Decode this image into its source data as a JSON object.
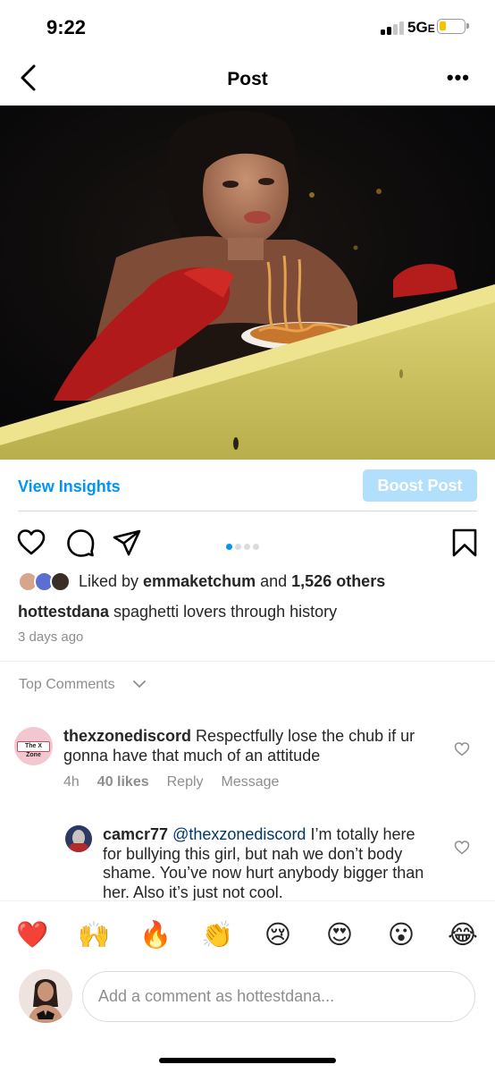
{
  "status_bar": {
    "time": "9:22",
    "network": "5G",
    "network_suffix": "E"
  },
  "nav": {
    "title": "Post",
    "more": "•••"
  },
  "insights": {
    "view_insights": "View Insights",
    "boost_post": "Boost Post"
  },
  "carousel": {
    "count": 4,
    "active_index": 0
  },
  "likes": {
    "prefix": "Liked by ",
    "user": "emmaketchum",
    "middle": " and ",
    "others": "1,526 others"
  },
  "caption": {
    "username": "hottestdana",
    "text": " spaghetti lovers through history"
  },
  "posted": "3 days ago",
  "top_comments_label": "Top Comments",
  "comments": [
    {
      "username": "thexzonediscord",
      "text": " Respectfully lose the chub if ur gonna have that much of an attitude",
      "time": "4h",
      "likes": "40 likes",
      "reply": "Reply",
      "message": "Message",
      "avatar_text": "The X Zone"
    },
    {
      "username": "camcr77",
      "mention": "@thexzonediscord",
      "text": " I’m totally here for bullying this girl, but nah we don’t body shame. You’ve now hurt anybody bigger than her. Also it’s just not cool."
    }
  ],
  "emoji_reactions": [
    "❤️",
    "🙌",
    "🔥",
    "👏",
    "😢",
    "😍",
    "😮",
    "😂"
  ],
  "composer": {
    "placeholder": "Add a comment as hottestdana..."
  },
  "colors": {
    "accent": "#0095f6",
    "boost_disabled": "#b2dffc",
    "muted": "#8e8e8e"
  }
}
